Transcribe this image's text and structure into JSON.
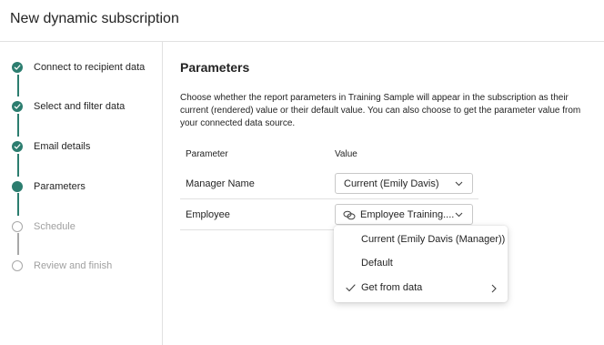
{
  "dialog": {
    "title": "New dynamic subscription"
  },
  "stepper": {
    "steps": [
      {
        "label": "Connect to recipient data",
        "state": "done"
      },
      {
        "label": "Select and filter data",
        "state": "done"
      },
      {
        "label": "Email details",
        "state": "done"
      },
      {
        "label": "Parameters",
        "state": "current"
      },
      {
        "label": "Schedule",
        "state": "todo"
      },
      {
        "label": "Review and finish",
        "state": "todo"
      }
    ]
  },
  "main": {
    "title": "Parameters",
    "description": "Choose whether the report parameters in Training Sample will appear in the subscription as their current (rendered) value or their default value. You can also choose to get the parameter value from your connected data source.",
    "table": {
      "headers": {
        "parameter": "Parameter",
        "value": "Value"
      },
      "rows": [
        {
          "name": "Manager Name",
          "value": "Current (Emily Davis)",
          "icon": "chevron-down-icon"
        },
        {
          "name": "Employee",
          "value": "Employee Training....",
          "icon": "link-icon"
        }
      ]
    }
  },
  "menu": {
    "items": [
      {
        "label": "Current (Emily Davis (Manager))",
        "checked": false
      },
      {
        "label": "Default",
        "checked": false
      },
      {
        "label": "Get from data",
        "checked": true,
        "submenu": true
      }
    ]
  },
  "colors": {
    "accent": "#2c7d6f",
    "border": "#e1e1e1",
    "disabled_text": "#a0a0a0"
  }
}
